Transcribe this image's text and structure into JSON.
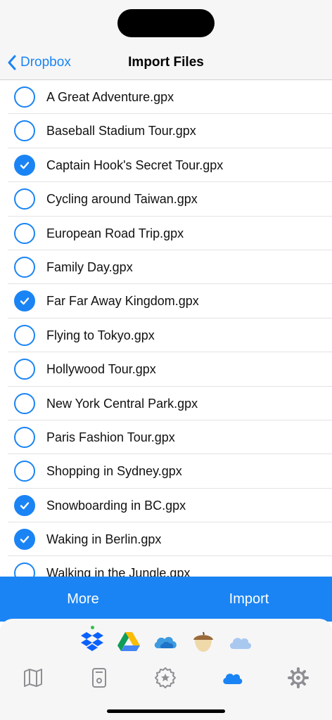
{
  "nav": {
    "back_label": "Dropbox",
    "title": "Import Files"
  },
  "files": [
    {
      "name": "A Great Adventure.gpx",
      "selected": false
    },
    {
      "name": "Baseball Stadium Tour.gpx",
      "selected": false
    },
    {
      "name": "Captain Hook's Secret Tour.gpx",
      "selected": true
    },
    {
      "name": "Cycling around Taiwan.gpx",
      "selected": false
    },
    {
      "name": "European Road Trip.gpx",
      "selected": false
    },
    {
      "name": "Family Day.gpx",
      "selected": false
    },
    {
      "name": "Far Far Away Kingdom.gpx",
      "selected": true
    },
    {
      "name": "Flying to Tokyo.gpx",
      "selected": false
    },
    {
      "name": "Hollywood Tour.gpx",
      "selected": false
    },
    {
      "name": "New York Central Park.gpx",
      "selected": false
    },
    {
      "name": "Paris Fashion Tour.gpx",
      "selected": false
    },
    {
      "name": "Shopping in Sydney.gpx",
      "selected": false
    },
    {
      "name": "Snowboarding in BC.gpx",
      "selected": true
    },
    {
      "name": "Waking in Berlin.gpx",
      "selected": true
    },
    {
      "name": "Walking in the Jungle.gpx",
      "selected": false
    }
  ],
  "actions": {
    "more_label": "More",
    "import_label": "Import"
  },
  "sources": [
    {
      "icon": "dropbox-icon",
      "active": true
    },
    {
      "icon": "google-drive-icon",
      "active": false
    },
    {
      "icon": "onedrive-icon",
      "active": false
    },
    {
      "icon": "acorn-icon",
      "active": false
    },
    {
      "icon": "icloud-icon",
      "active": false
    }
  ],
  "tabs": [
    {
      "icon": "map-icon",
      "active": false
    },
    {
      "icon": "device-icon",
      "active": false
    },
    {
      "icon": "badge-icon",
      "active": false
    },
    {
      "icon": "cloud-icon",
      "active": true
    },
    {
      "icon": "gear-icon",
      "active": false
    }
  ],
  "colors": {
    "accent": "#1a84f4",
    "active_dot": "#2fbf4a",
    "inactive_icon": "#8e8e93"
  }
}
